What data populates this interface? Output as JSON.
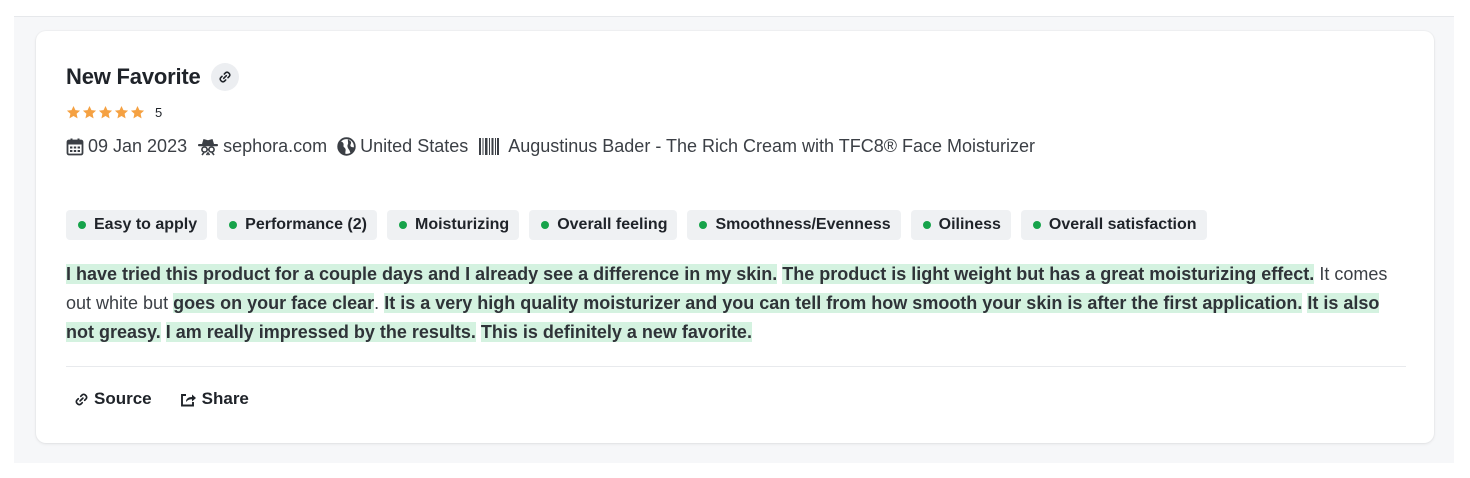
{
  "review": {
    "title": "New Favorite",
    "rating": 5,
    "rating_label": "5",
    "date": "09 Jan 2023",
    "source_site": "sephora.com",
    "country": "United States",
    "product": "Augustinus Bader - The Rich Cream with TFC8® Face Moisturizer",
    "tags": [
      {
        "label": "Easy to apply",
        "color": "#16a34a"
      },
      {
        "label": "Performance (2)",
        "color": "#16a34a"
      },
      {
        "label": "Moisturizing",
        "color": "#16a34a"
      },
      {
        "label": "Overall feeling",
        "color": "#16a34a"
      },
      {
        "label": "Smoothness/Evenness",
        "color": "#16a34a"
      },
      {
        "label": "Oiliness",
        "color": "#16a34a"
      },
      {
        "label": "Overall satisfaction",
        "color": "#16a34a"
      }
    ],
    "segments": [
      {
        "text": "I have tried this product for a couple days and I already see a difference in my skin.",
        "highlight": true
      },
      {
        "text": "The product is light weight but has a great moisturizing effect.",
        "highlight": true
      },
      {
        "text": "It comes out white but",
        "highlight": false
      },
      {
        "text": "goes on your face clear",
        "highlight": true
      },
      {
        "text": ".",
        "highlight": false
      },
      {
        "text": "It is a very high quality moisturizer and you can tell from how smooth your skin is after the first application.",
        "highlight": true
      },
      {
        "text": "It is also not greasy.",
        "highlight": true
      },
      {
        "text": "I am really impressed by the results.",
        "highlight": true
      },
      {
        "text": "This is definitely a new favorite.",
        "highlight": true
      }
    ]
  },
  "actions": {
    "source_label": "Source",
    "share_label": "Share"
  },
  "colors": {
    "star": "#f5a142",
    "tag_dot": "#16a34a",
    "highlight": "#d4f2e0"
  }
}
